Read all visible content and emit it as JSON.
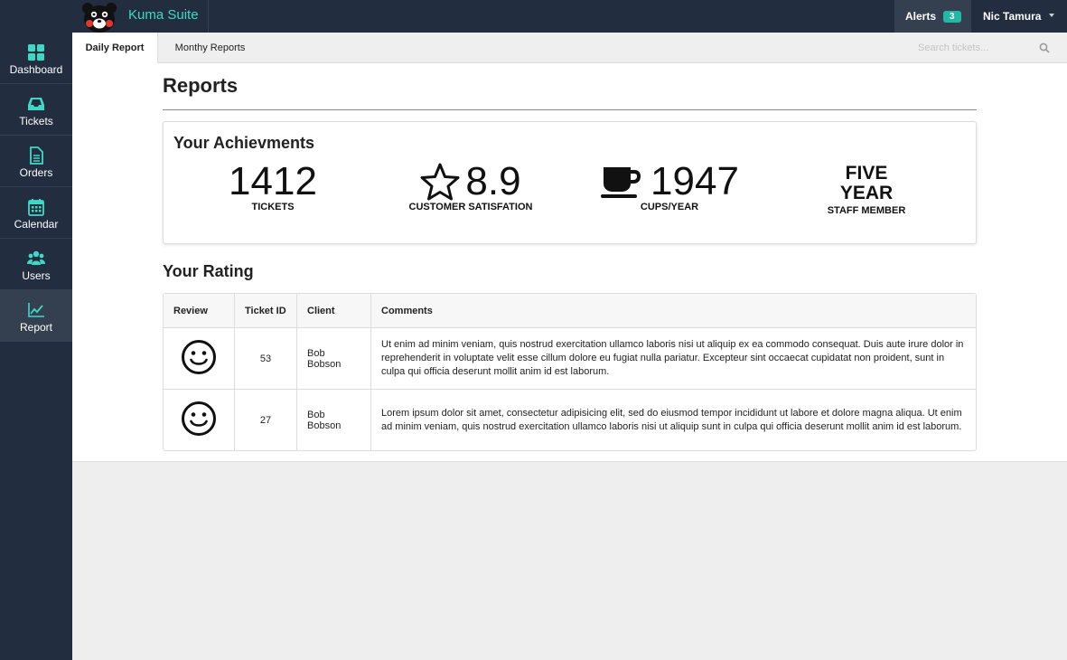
{
  "app": {
    "brand_name": "Kuma Suite",
    "accent_color": "#3ed9c6",
    "topbar_color": "#222d3f"
  },
  "topbar": {
    "alerts_label": "Alerts",
    "alerts_count": "3",
    "user_name": "Nic Tamura"
  },
  "sidebar": {
    "items": [
      {
        "label": "Dashboard",
        "icon": "grid-icon"
      },
      {
        "label": "Tickets",
        "icon": "inbox-icon"
      },
      {
        "label": "Orders",
        "icon": "document-icon"
      },
      {
        "label": "Calendar",
        "icon": "calendar-icon"
      },
      {
        "label": "Users",
        "icon": "users-icon"
      },
      {
        "label": "Report",
        "icon": "line-chart-icon",
        "active": true
      }
    ]
  },
  "tabs": [
    {
      "label": "Daily Report",
      "active": true
    },
    {
      "label": "Monthy Reports",
      "active": false
    }
  ],
  "search": {
    "placeholder": "Search tickets..."
  },
  "page": {
    "title": "Reports"
  },
  "achievements": {
    "title": "Your Achievments",
    "stats": [
      {
        "value": "1412",
        "label": "TICKETS"
      },
      {
        "value": "8.9",
        "label": "CUSTOMER SATISFATION",
        "icon": "star-icon"
      },
      {
        "value": "1947",
        "label": "CUPS/YEAR",
        "icon": "coffee-cup-icon"
      },
      {
        "line1": "FIVE",
        "line2": "YEAR",
        "label": "STAFF MEMBER"
      }
    ]
  },
  "rating": {
    "title": "Your Rating",
    "columns": [
      "Review",
      "Ticket ID",
      "Client",
      "Comments"
    ],
    "rows": [
      {
        "review_icon": "smiley-icon",
        "ticket_id": "53",
        "client": "Bob Bobson",
        "comment": "Ut enim ad minim veniam, quis nostrud exercitation ullamco laboris nisi ut aliquip ex ea commodo consequat. Duis aute irure dolor in reprehenderit in voluptate velit esse cillum dolore eu fugiat nulla pariatur. Excepteur sint occaecat cupidatat non proident, sunt in culpa qui officia deserunt mollit anim id est laborum."
      },
      {
        "review_icon": "smiley-icon",
        "ticket_id": "27",
        "client": "Bob Bobson",
        "comment": "Lorem ipsum dolor sit amet, consectetur adipisicing elit, sed do eiusmod tempor incididunt ut labore et dolore magna aliqua. Ut enim ad minim veniam, quis nostrud exercitation ullamco laboris nisi ut aliquip sunt in culpa qui officia deserunt mollit anim id est laborum."
      }
    ]
  }
}
